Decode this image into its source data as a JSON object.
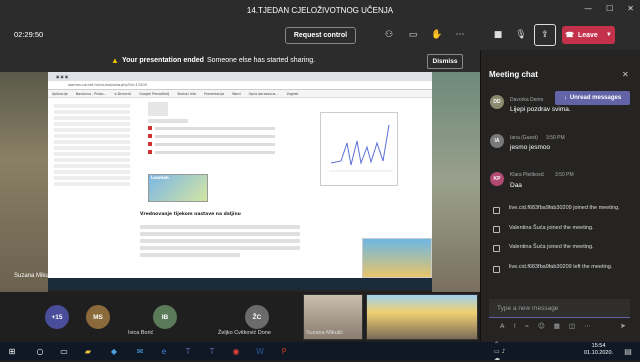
{
  "window": {
    "title": "14.TJEDAN CJELOŽIVOTNOG UČENJA"
  },
  "toolbar": {
    "timer": "02:29:50",
    "request_control": "Request control",
    "leave": "Leave"
  },
  "banner": {
    "bold": "Your presentation ended",
    "text": "Someone else has started sharing.",
    "dismiss": "Dismiss"
  },
  "shared_screen": {
    "url": "loomen.carnet.hr/course/view.php?id=11500",
    "bookmarks": [
      "Aplikacije",
      "Naslovna - Pristo...",
      "e-Dnevnik",
      "Google Prevoditelj",
      "Skolski Info",
      "Prezentacija",
      "Word",
      "Opća obrazovna...",
      "Zagreb"
    ],
    "section_title": "Vrednovanje tijekom nastave na daljinu",
    "lesson_label": "Loomen"
  },
  "presenter": {
    "name": "Suzana Mikulić"
  },
  "participants": {
    "overflow": "+15",
    "tiles": [
      {
        "initials": "MS",
        "name": "",
        "color": "#8a6a3a"
      },
      {
        "initials": "IB",
        "name": "Ivica Borić",
        "color": "#5a7a5a"
      },
      {
        "initials": "ŽC",
        "name": "Željko Cvitković Done",
        "color": "#6b6b6b"
      }
    ],
    "video_name": "Suzana Mikulić"
  },
  "chat": {
    "title": "Meeting chat",
    "unread_label": "Unread messages",
    "messages": [
      {
        "initials": "DD",
        "author": "Davorka Demo",
        "time": "",
        "text": "Lijepi pozdrav svima.",
        "color": "#8b8b6e"
      },
      {
        "initials": "IA",
        "author": "Iana (Guest)",
        "time": "3:50 PM",
        "text": "jesmo jesmoo",
        "color": "#7a7a7a"
      },
      {
        "initials": "KP",
        "author": "Klara Pletikosić",
        "time": "3:50 PM",
        "text": "Daa",
        "color": "#b04a72"
      }
    ],
    "system": [
      "live.cid.f683fba9fab30209 joined the meeting.",
      "Valentina Šuća joined the meeting.",
      "Valentina Šuća joined the meeting.",
      "live.cid.f683fba9fab30209 left the meeting."
    ],
    "input_placeholder": "Type a new message"
  },
  "taskbar": {
    "time": "15:54",
    "date": "01.10.2020."
  }
}
